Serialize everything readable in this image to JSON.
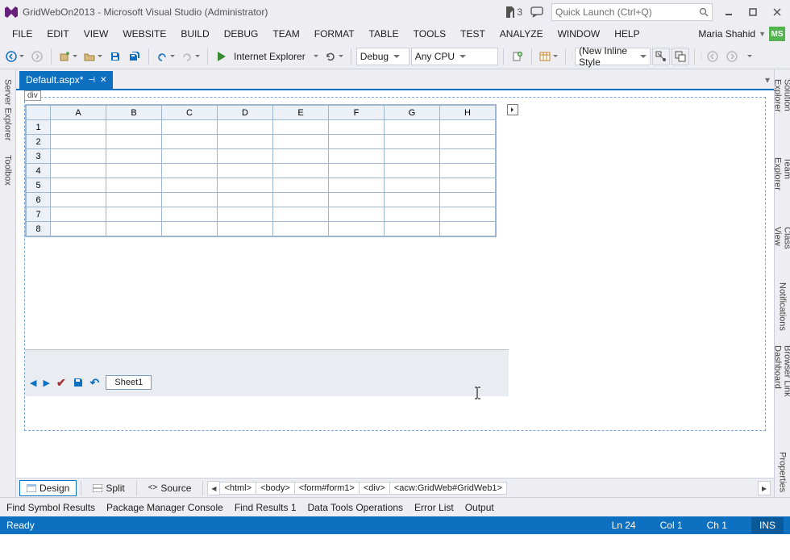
{
  "title": "GridWebOn2013 - Microsoft Visual Studio (Administrator)",
  "notif_count": "3",
  "quick_launch_placeholder": "Quick Launch (Ctrl+Q)",
  "user": {
    "name": "Maria Shahid",
    "initials": "MS"
  },
  "menu": [
    "FILE",
    "EDIT",
    "VIEW",
    "WEBSITE",
    "BUILD",
    "DEBUG",
    "TEAM",
    "FORMAT",
    "TABLE",
    "TOOLS",
    "TEST",
    "ANALYZE",
    "WINDOW",
    "HELP"
  ],
  "toolbar": {
    "browser": "Internet Explorer",
    "config": "Debug",
    "platform": "Any CPU",
    "style": "(New Inline Style"
  },
  "left_tabs": [
    "Server Explorer",
    "Toolbox"
  ],
  "right_tabs": [
    "Solution Explorer",
    "Team Explorer",
    "Class View",
    "Notifications",
    "Browser Link Dashboard",
    "Properties"
  ],
  "doc_tab": "Default.aspx*",
  "div_tag": "div",
  "grid": {
    "columns": [
      "A",
      "B",
      "C",
      "D",
      "E",
      "F",
      "G",
      "H"
    ],
    "rows": [
      "1",
      "2",
      "3",
      "4",
      "5",
      "6",
      "7",
      "8"
    ],
    "sheet": "Sheet1"
  },
  "view_buttons": {
    "design": "Design",
    "split": "Split",
    "source": "Source"
  },
  "breadcrumb": [
    "<html>",
    "<body>",
    "<form#form1>",
    "<div>",
    "<acw:GridWeb#GridWeb1>"
  ],
  "bottom_tabs": [
    "Find Symbol Results",
    "Package Manager Console",
    "Find Results 1",
    "Data Tools Operations",
    "Error List",
    "Output"
  ],
  "status": {
    "ready": "Ready",
    "ln": "Ln 24",
    "col": "Col 1",
    "ch": "Ch 1",
    "ins": "INS"
  }
}
